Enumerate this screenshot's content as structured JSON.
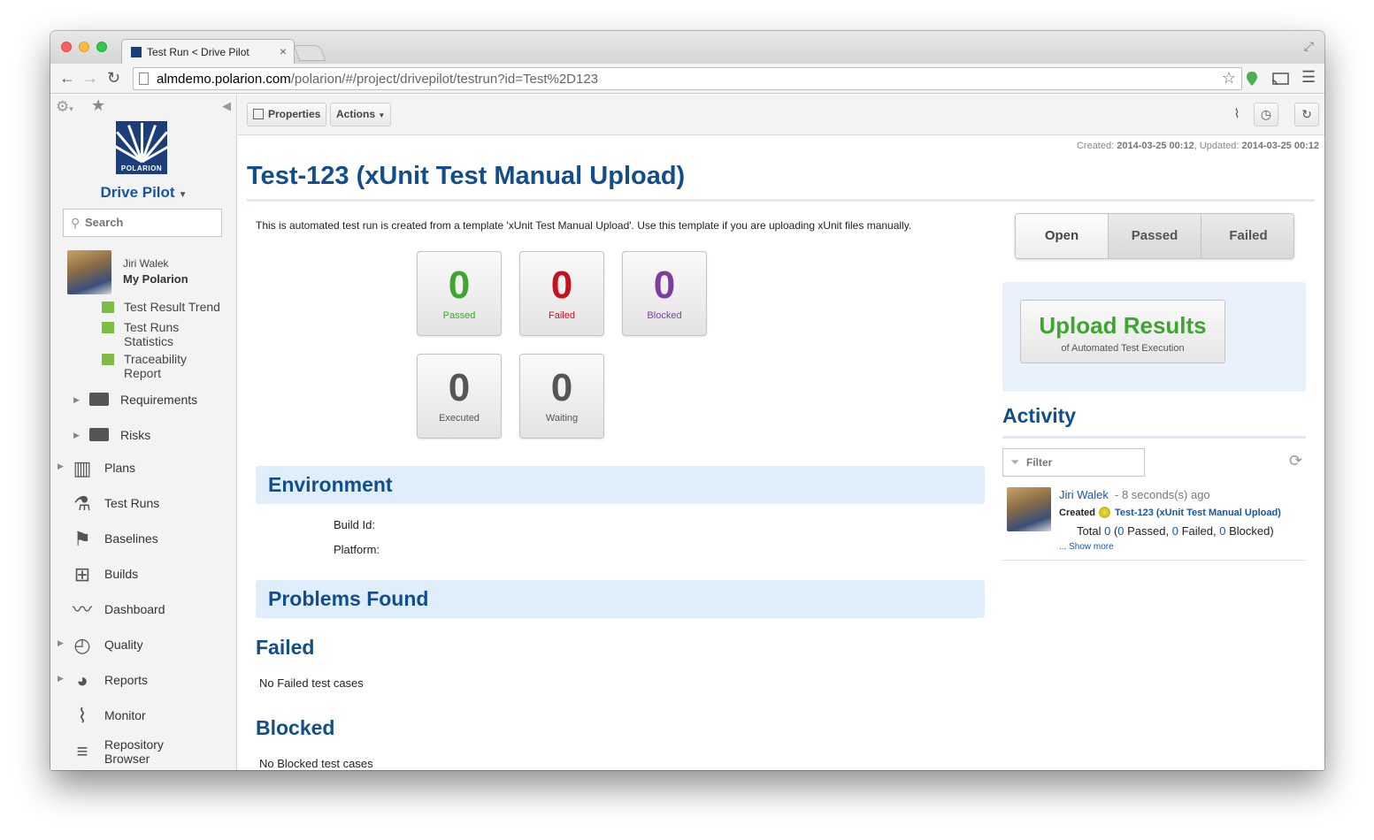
{
  "browser": {
    "tab_title": "Test Run < Drive Pilot",
    "tab_close": "×",
    "url_host": "almdemo.polarion.com",
    "url_path": "/polarion/#/project/drivepilot/testrun?id=Test%2D123"
  },
  "sidebar": {
    "logo_text": "POLARION",
    "project_name": "Drive Pilot",
    "search_placeholder": "Search",
    "user_name": "Jiri Walek",
    "my_polarion": "My Polarion",
    "reports": [
      {
        "label": "Test Result Trend"
      },
      {
        "label": "Test Runs Statistics"
      },
      {
        "label": "Traceability Report"
      }
    ],
    "folders": [
      {
        "label": "Requirements"
      },
      {
        "label": "Risks"
      }
    ],
    "nav": [
      {
        "label": "Plans",
        "icon": "bar-chart-icon"
      },
      {
        "label": "Test Runs",
        "icon": "flask-icon"
      },
      {
        "label": "Baselines",
        "icon": "flag-icon"
      },
      {
        "label": "Builds",
        "icon": "gift-icon"
      },
      {
        "label": "Dashboard",
        "icon": "line-chart-icon"
      },
      {
        "label": "Quality",
        "icon": "gauge-icon"
      },
      {
        "label": "Reports",
        "icon": "pie-chart-icon"
      },
      {
        "label": "Monitor",
        "icon": "heartbeat-icon"
      },
      {
        "label": "Repository Browser",
        "icon": "database-icon"
      }
    ]
  },
  "toolbar": {
    "properties_label": "Properties",
    "actions_label": "Actions"
  },
  "page": {
    "created_label": "Created:",
    "created_value": "2014-03-25 00:12",
    "updated_label": ", Updated:",
    "updated_value": "2014-03-25 00:12",
    "title": "Test-123 (xUnit Test Manual Upload)",
    "description": "This is automated test run is created from a template 'xUnit Test Manual Upload'. Use this template if you are uploading xUnit files manually.",
    "stats": [
      {
        "value": "0",
        "label": "Passed",
        "color": "#3ea531"
      },
      {
        "value": "0",
        "label": "Failed",
        "color": "#c8101e"
      },
      {
        "value": "0",
        "label": "Blocked",
        "color": "#7d3da0"
      },
      {
        "value": "0",
        "label": "Executed",
        "color": "#555555"
      },
      {
        "value": "0",
        "label": "Waiting",
        "color": "#555555"
      }
    ],
    "environment_heading": "Environment",
    "build_id_label": "Build Id:",
    "platform_label": "Platform:",
    "problems_heading": "Problems Found",
    "failed_heading": "Failed",
    "failed_note": "No Failed test cases",
    "blocked_heading": "Blocked",
    "blocked_note": "No Blocked test cases"
  },
  "status_buttons": [
    {
      "label": "Open",
      "active": true
    },
    {
      "label": "Passed",
      "active": false
    },
    {
      "label": "Failed",
      "active": false
    }
  ],
  "upload": {
    "title": "Upload Results",
    "subtitle": "of Automated Test Execution"
  },
  "activity": {
    "heading": "Activity",
    "filter_placeholder": "Filter",
    "user": "Jiri Walek",
    "time": "- 8 seconds(s) ago",
    "action": "Created",
    "link": "Test-123 (xUnit Test Manual Upload)",
    "total_label": "Total",
    "total": "0",
    "passed": "0",
    "passed_label": "Passed,",
    "failed": "0",
    "failed_label": "Failed,",
    "blocked": "0",
    "blocked_label": "Blocked)",
    "show_more": "... Show more"
  },
  "colors": {
    "accent": "#124e8c",
    "link": "#1a55a5",
    "upload_green": "#3ea531"
  }
}
